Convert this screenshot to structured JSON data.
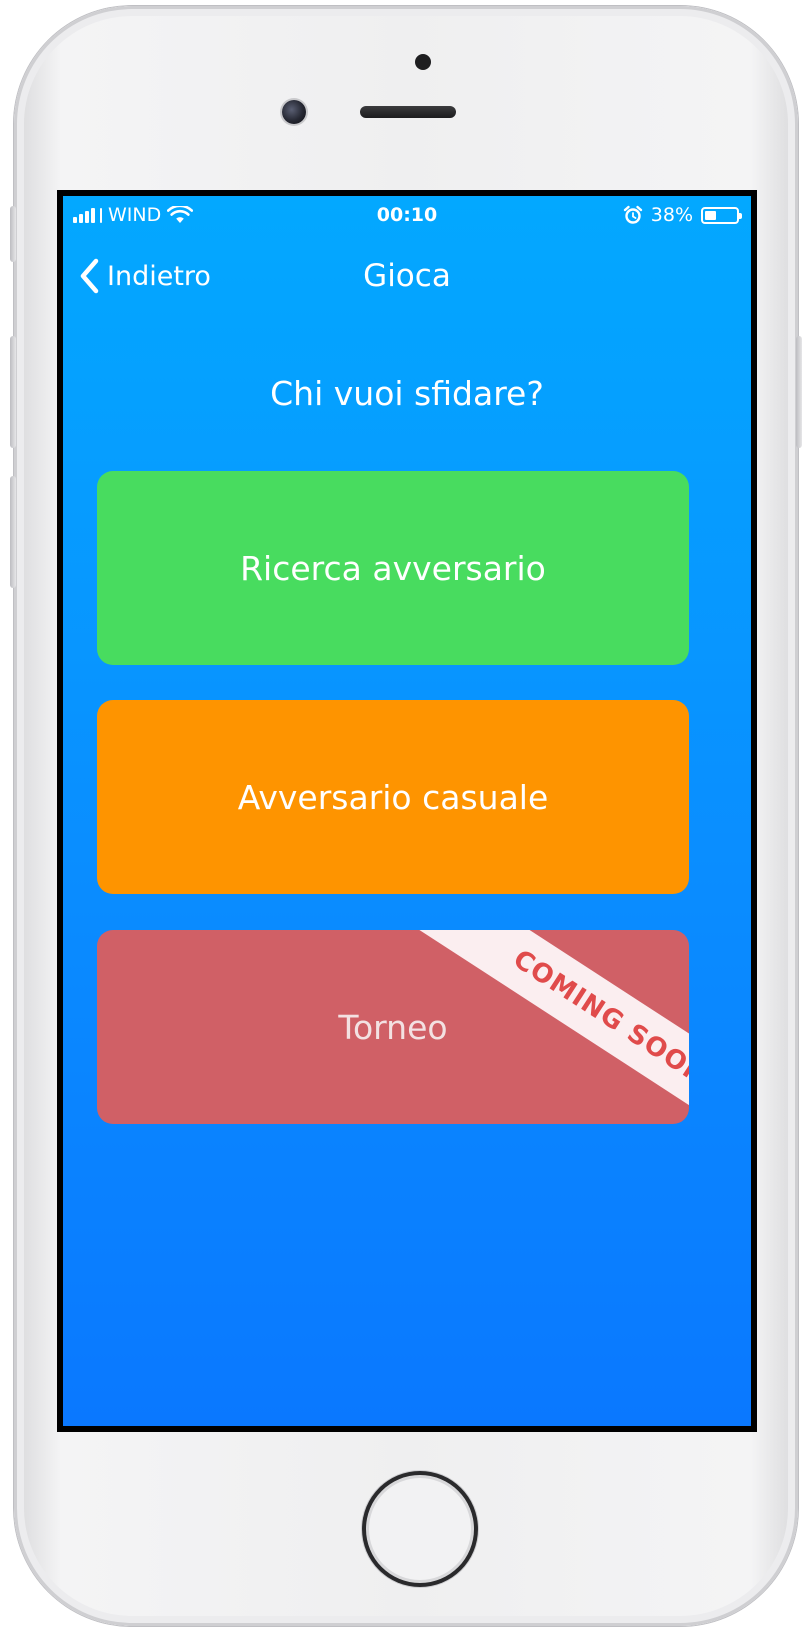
{
  "status_bar": {
    "carrier": "WIND",
    "time": "00:10",
    "battery_percent": "38%",
    "battery_level": 0.38,
    "icons": [
      "signal-bars-icon",
      "wifi-icon",
      "alarm-icon",
      "battery-icon"
    ]
  },
  "nav": {
    "back_label": "Indietro",
    "title": "Gioca"
  },
  "main": {
    "prompt": "Chi vuoi sfidare?",
    "options": [
      {
        "label": "Ricerca avversario",
        "color": "#48dc5f"
      },
      {
        "label": "Avversario casuale",
        "color": "#fe9400"
      },
      {
        "label": "Torneo",
        "color": "#d06066",
        "ribbon": "COMING SOON"
      }
    ]
  },
  "colors": {
    "background_top": "#03a8ff",
    "background_bottom": "#0a78ff",
    "ribbon_text": "#e04b4b",
    "ribbon_background": "#fbeef0"
  }
}
